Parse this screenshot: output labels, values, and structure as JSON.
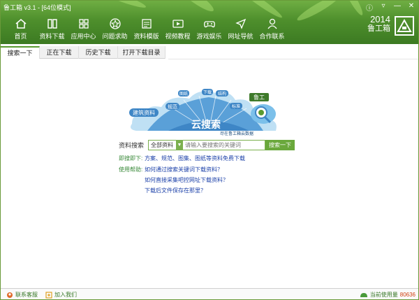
{
  "window": {
    "title": "鲁工箱 v3.1 - [64位模式]",
    "controls": [
      "ⓘ",
      "▿",
      "—",
      "✕"
    ]
  },
  "nav": [
    {
      "label": "首页",
      "icon": "home-icon"
    },
    {
      "label": "资料下载",
      "icon": "book-icon"
    },
    {
      "label": "应用中心",
      "icon": "grid-icon"
    },
    {
      "label": "问题求助",
      "icon": "help-icon"
    },
    {
      "label": "资料模版",
      "icon": "template-icon"
    },
    {
      "label": "视频教程",
      "icon": "video-icon"
    },
    {
      "label": "游戏娱乐",
      "icon": "gamepad-icon"
    },
    {
      "label": "网址导航",
      "icon": "navigation-icon"
    },
    {
      "label": "合作联系",
      "icon": "contact-icon"
    }
  ],
  "brand": {
    "year": "2014",
    "name": "鲁工箱"
  },
  "tabs": [
    "搜索一下",
    "正在下载",
    "历史下载",
    "打开下载目录"
  ],
  "cloud": {
    "title": "云搜索",
    "subtitle": "尽在鲁工箱云数据",
    "tags": [
      "建筑资料",
      "规范",
      "图纸",
      "下载",
      "结构",
      "标准",
      "鲁工"
    ]
  },
  "search": {
    "label": "资料搜索",
    "category": "全部资料",
    "placeholder": "请输入要搜索的关键词",
    "button": "搜索一下"
  },
  "info": {
    "instant_key": "即搜即下:",
    "instant_text": "方案、规范、图集、图纸等资料免费下载",
    "help_key": "使用帮助:",
    "help_links": [
      "如何通过搜索关键词下载资料？",
      "如何直接采集吧控网址下载资料？",
      "下载后文件保存在那里？"
    ]
  },
  "status": {
    "service": "联系客服",
    "join": "加入我们",
    "usage_label": "当前使用量",
    "usage_value": "80636"
  },
  "colors": {
    "banner": "#4e8f2c",
    "accent": "#6aa83c",
    "link": "#1a3fa8",
    "cloud": "#5aa0d8"
  }
}
